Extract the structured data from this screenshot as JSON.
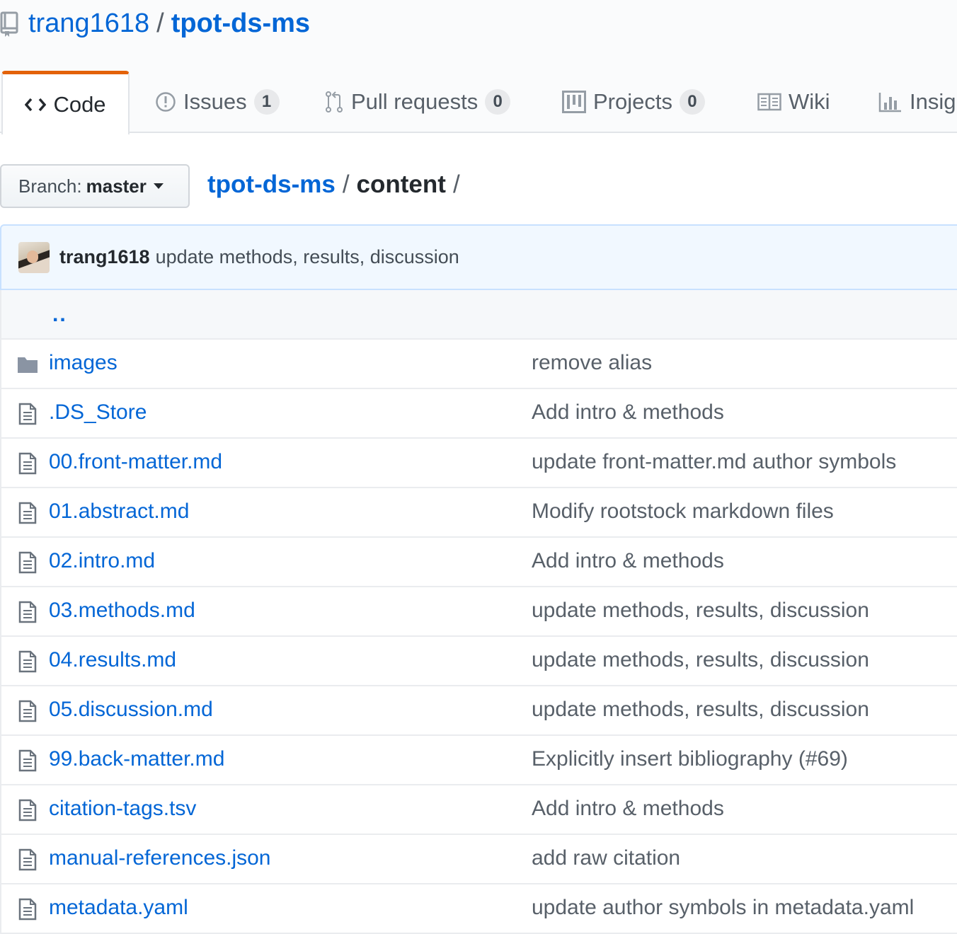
{
  "repo": {
    "owner": "trang1618",
    "separator": "/",
    "name": "tpot-ds-ms"
  },
  "tabs": [
    {
      "label": "Code",
      "icon": "code-icon",
      "selected": true
    },
    {
      "label": "Issues",
      "icon": "issue-opened-icon",
      "count": "1"
    },
    {
      "label": "Pull requests",
      "icon": "git-pull-request-icon",
      "count": "0"
    },
    {
      "label": "Projects",
      "icon": "project-icon",
      "count": "0"
    },
    {
      "label": "Wiki",
      "icon": "book-icon"
    },
    {
      "label": "Insig",
      "icon": "graph-icon"
    }
  ],
  "branch": {
    "label": "Branch:",
    "value": "master"
  },
  "breadcrumb": {
    "root": "tpot-ds-ms",
    "sep": "/",
    "current": "content",
    "trailing": "/"
  },
  "latest_commit": {
    "author": "trang1618",
    "message": "update methods, results, discussion"
  },
  "parent_dir": "..",
  "files": [
    {
      "type": "directory",
      "icon": "file-directory-icon",
      "name": "images",
      "message": "remove alias"
    },
    {
      "type": "file",
      "icon": "file-icon",
      "name": ".DS_Store",
      "message": "Add intro & methods"
    },
    {
      "type": "file",
      "icon": "file-icon",
      "name": "00.front-matter.md",
      "message": "update front-matter.md author symbols"
    },
    {
      "type": "file",
      "icon": "file-icon",
      "name": "01.abstract.md",
      "message": "Modify rootstock markdown files"
    },
    {
      "type": "file",
      "icon": "file-icon",
      "name": "02.intro.md",
      "message": "Add intro & methods"
    },
    {
      "type": "file",
      "icon": "file-icon",
      "name": "03.methods.md",
      "message": "update methods, results, discussion"
    },
    {
      "type": "file",
      "icon": "file-icon",
      "name": "04.results.md",
      "message": "update methods, results, discussion"
    },
    {
      "type": "file",
      "icon": "file-icon",
      "name": "05.discussion.md",
      "message": "update methods, results, discussion"
    },
    {
      "type": "file",
      "icon": "file-icon",
      "name": "99.back-matter.md",
      "message": "Explicitly insert bibliography (#69)"
    },
    {
      "type": "file",
      "icon": "file-icon",
      "name": "citation-tags.tsv",
      "message": "Add intro & methods"
    },
    {
      "type": "file",
      "icon": "file-icon",
      "name": "manual-references.json",
      "message": "add raw citation"
    },
    {
      "type": "file",
      "icon": "file-icon",
      "name": "metadata.yaml",
      "message": "update author symbols in metadata.yaml"
    }
  ],
  "colors": {
    "link": "#0366d6",
    "selected_tab_accent": "#e36209",
    "commit_bg": "#f1f8ff",
    "muted_text": "#586069"
  }
}
